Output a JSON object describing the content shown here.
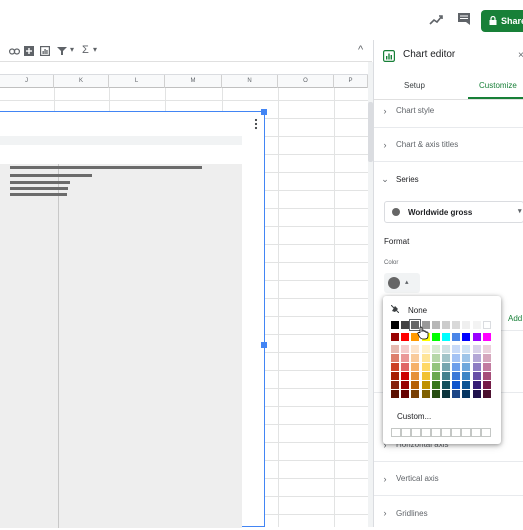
{
  "topbar": {
    "share_label": "Share",
    "trend_icon": "trending-icon",
    "comment_icon": "comment-icon"
  },
  "toolbar": {
    "sigma": "Σ",
    "collapse": "^"
  },
  "columns": [
    "J",
    "K",
    "L",
    "M",
    "N",
    "O",
    "P"
  ],
  "editor": {
    "title": "Chart editor",
    "tabs": [
      {
        "label": "Setup"
      },
      {
        "label": "Customize"
      }
    ],
    "sections": [
      {
        "label": "Chart style"
      },
      {
        "label": "Chart & axis titles"
      },
      {
        "label": "Series"
      },
      {
        "label": "Horizontal axis"
      },
      {
        "label": "Vertical axis"
      },
      {
        "label": "Gridlines"
      }
    ],
    "series_select": "Worldwide gross",
    "format_label": "Format",
    "color_label": "Color",
    "add_label": "Add"
  },
  "palette": {
    "none_label": "None",
    "custom_label": "Custom...",
    "selected_color": "#666666",
    "rows": [
      [
        "#000000",
        "#434343",
        "#666666",
        "#999999",
        "#b7b7b7",
        "#cccccc",
        "#d9d9d9",
        "#efefef",
        "#f3f3f3",
        "#ffffff"
      ],
      [
        "#980000",
        "#ff0000",
        "#ff9900",
        "#ffff00",
        "#00ff00",
        "#00ffff",
        "#4a86e8",
        "#0000ff",
        "#9900ff",
        "#ff00ff"
      ],
      [
        "#e6b8af",
        "#f4cccc",
        "#fce5cd",
        "#fff2cc",
        "#d9ead3",
        "#d0e0e3",
        "#c9daf8",
        "#cfe2f3",
        "#d9d2e9",
        "#ead1dc"
      ],
      [
        "#dd7e6b",
        "#ea9999",
        "#f9cb9c",
        "#ffe599",
        "#b6d7a8",
        "#a2c4c9",
        "#a4c2f4",
        "#9fc5e8",
        "#b4a7d6",
        "#d5a6bd"
      ],
      [
        "#cc4125",
        "#e06666",
        "#f6b26b",
        "#ffd966",
        "#93c47d",
        "#76a5af",
        "#6d9eeb",
        "#6fa8dc",
        "#8e7cc3",
        "#c27ba0"
      ],
      [
        "#a61c00",
        "#cc0000",
        "#e69138",
        "#f1c232",
        "#6aa84f",
        "#45818e",
        "#3c78d8",
        "#3d85c6",
        "#674ea7",
        "#a64d79"
      ],
      [
        "#85200c",
        "#990000",
        "#b45f06",
        "#bf9000",
        "#38761d",
        "#134f5c",
        "#1155cc",
        "#0b5394",
        "#351c75",
        "#741b47"
      ],
      [
        "#5b0f00",
        "#660000",
        "#783f04",
        "#7f6000",
        "#274e13",
        "#0c343d",
        "#1c4587",
        "#073763",
        "#20124d",
        "#4c1130"
      ]
    ]
  },
  "chart_bars": {
    "count": 5
  }
}
